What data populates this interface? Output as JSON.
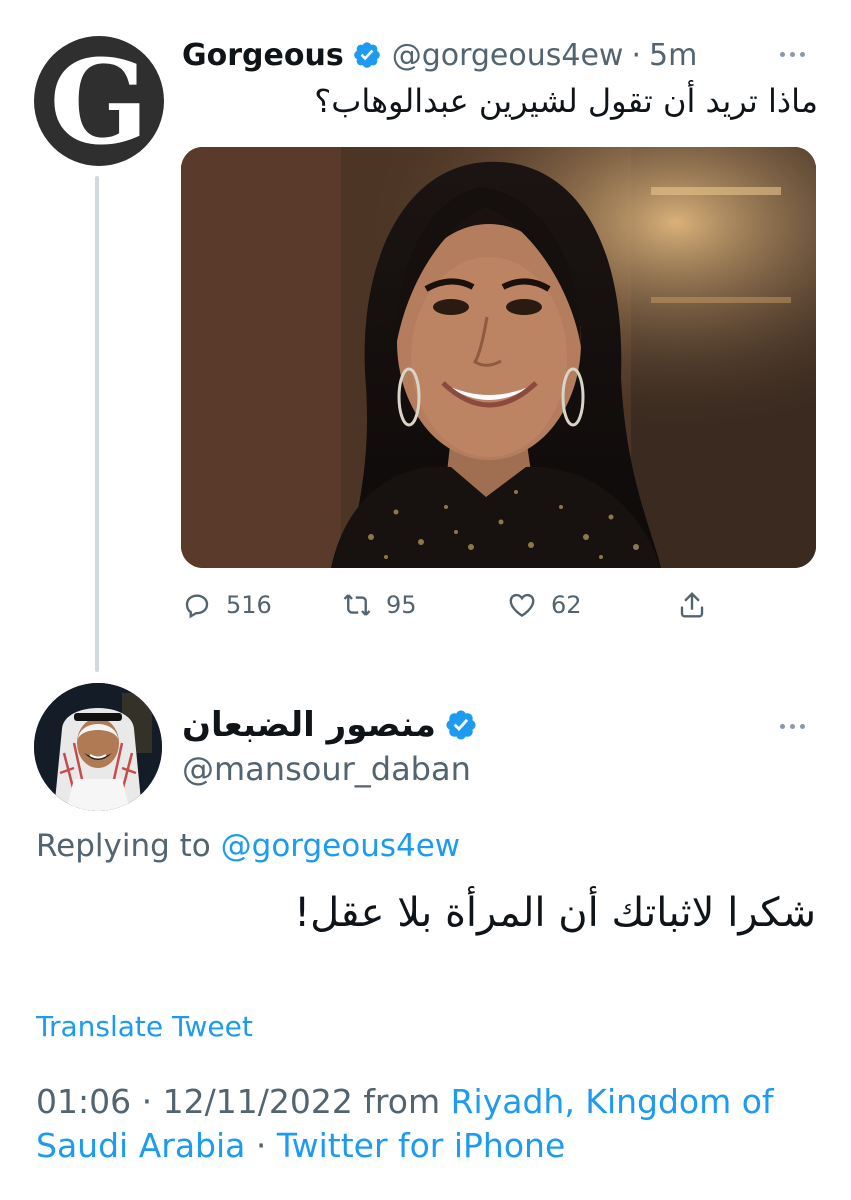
{
  "parent_tweet": {
    "display_name": "Gorgeous",
    "handle": "@gorgeous4ew",
    "separator": "·",
    "time_ago": "5m",
    "text": "ماذا تريد أن تقول لشيرين عبدالوهاب؟",
    "avatar_letter": "G",
    "stats": {
      "replies": "516",
      "retweets": "95",
      "likes": "62"
    }
  },
  "reply_tweet": {
    "display_name": "منصور الضبعان",
    "handle": "@mansour_daban",
    "replying_prefix": "Replying to",
    "replying_to": "@gorgeous4ew",
    "text": "شكرا لاثباتك أن المرأة بلا عقل!",
    "translate_label": "Translate Tweet",
    "time": "01:06",
    "dot1": "·",
    "date": "12/11/2022",
    "from_label": "from",
    "location": "Riyadh, Kingdom of Saudi Arabia",
    "dot2": "·",
    "client": "Twitter for iPhone"
  },
  "colors": {
    "accent": "#1d9bf0",
    "secondary_text": "#536471",
    "primary_text": "#0f1419",
    "thread_line": "#cfd9de"
  },
  "icons": {
    "verified": "verified-badge-icon",
    "more": "more-dots-icon",
    "reply": "reply-icon",
    "retweet": "retweet-icon",
    "like": "heart-icon",
    "share": "share-icon"
  }
}
